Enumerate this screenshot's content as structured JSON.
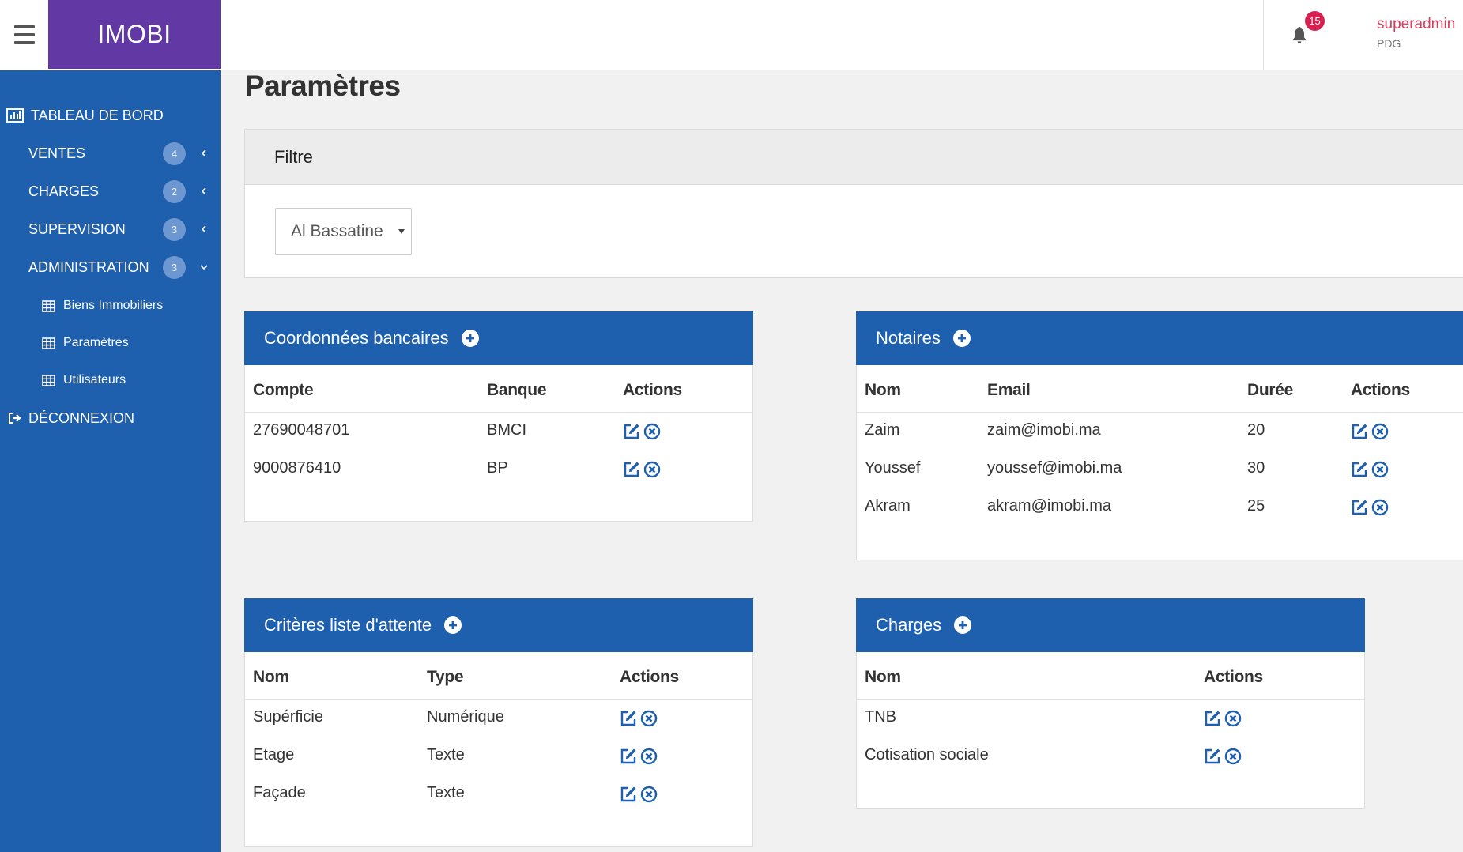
{
  "app": {
    "brand": "IMOBI"
  },
  "header": {
    "notifications_count": "15",
    "user_name": "superadmin",
    "user_role": "PDG"
  },
  "sidebar": {
    "items": [
      {
        "label": "TABLEAU DE BORD",
        "icon": "bar-chart-icon"
      },
      {
        "label": "VENTES",
        "badge": "4",
        "chevron": "left"
      },
      {
        "label": "CHARGES",
        "badge": "2",
        "chevron": "left"
      },
      {
        "label": "SUPERVISION",
        "badge": "3",
        "chevron": "left"
      },
      {
        "label": "ADMINISTRATION",
        "badge": "3",
        "chevron": "down"
      }
    ],
    "subitems": [
      {
        "label": "Biens Immobiliers",
        "icon": "table-icon"
      },
      {
        "label": "Paramètres",
        "icon": "table-icon"
      },
      {
        "label": "Utilisateurs",
        "icon": "table-icon"
      }
    ],
    "logout": {
      "label": "DÉCONNEXION",
      "icon": "sign-out-icon"
    }
  },
  "page": {
    "title": "Paramètres"
  },
  "filter": {
    "title": "Filtre",
    "selected": "Al Bassatine"
  },
  "bank": {
    "title": "Coordonnées bancaires",
    "columns": [
      "Compte",
      "Banque",
      "Actions"
    ],
    "rows": [
      {
        "compte": "27690048701",
        "banque": "BMCI"
      },
      {
        "compte": "9000876410",
        "banque": "BP"
      }
    ]
  },
  "notaires": {
    "title": "Notaires",
    "columns": [
      "Nom",
      "Email",
      "Durée",
      "Actions"
    ],
    "rows": [
      {
        "nom": "Zaim",
        "email": "zaim@imobi.ma",
        "duree": "20"
      },
      {
        "nom": "Youssef",
        "email": "youssef@imobi.ma",
        "duree": "30"
      },
      {
        "nom": "Akram",
        "email": "akram@imobi.ma",
        "duree": "25"
      }
    ]
  },
  "criteres": {
    "title": "Critères liste d'attente",
    "columns": [
      "Nom",
      "Type",
      "Actions"
    ],
    "rows": [
      {
        "nom": "Supérficie",
        "type": "Numérique"
      },
      {
        "nom": "Etage",
        "type": "Texte"
      },
      {
        "nom": "Façade",
        "type": "Texte"
      }
    ]
  },
  "charges": {
    "title": "Charges",
    "columns": [
      "Nom",
      "Actions"
    ],
    "rows": [
      {
        "nom": "TNB"
      },
      {
        "nom": "Cotisation sociale"
      }
    ]
  },
  "colors": {
    "sidebar": "#1e5fae",
    "brand": "#6138a4",
    "accent": "#1e5fae",
    "user": "#d63c5e",
    "badge": "#d6204f"
  }
}
